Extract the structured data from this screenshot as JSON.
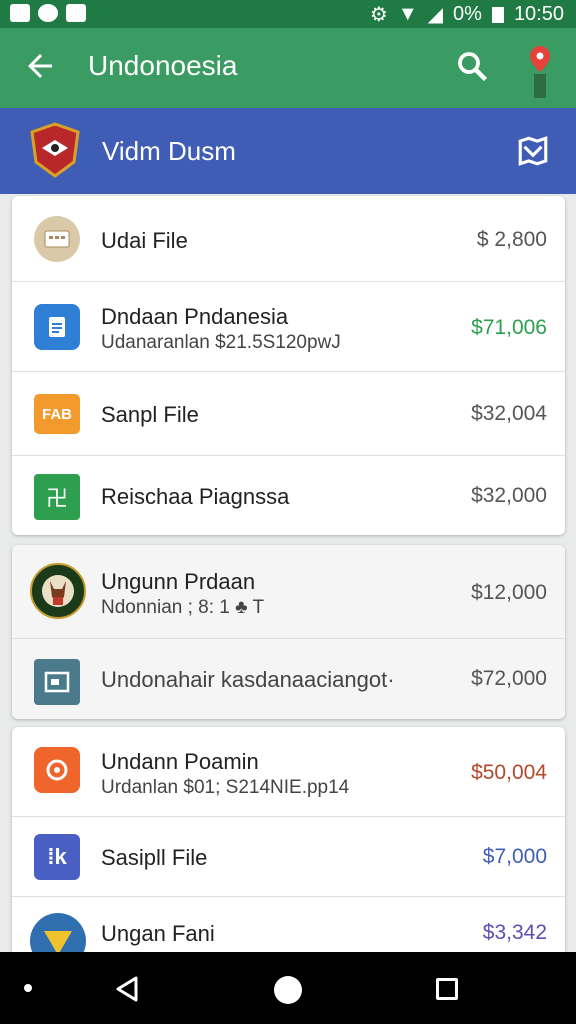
{
  "status_bar": {
    "battery": "0%",
    "time": "10:50"
  },
  "app_bar": {
    "title": "Undonoesia"
  },
  "sub_header": {
    "title": "Vidm Dusm"
  },
  "cards": [
    {
      "rows": [
        {
          "icon": "keyboard-icon",
          "icon_color": "#d9c9a8",
          "title": "Udai File",
          "subtitle": "",
          "amount": "$ 2,800",
          "amount_color": "#555555"
        },
        {
          "icon": "document-icon",
          "icon_color": "#2f7fd6",
          "title": "Dndaan Pndanesia",
          "subtitle": "Udanaranlan $21.5S120pwJ",
          "amount": "$71,006",
          "amount_color": "#2e9e4f"
        },
        {
          "icon": "folder-icon",
          "icon_color": "#f39a2d",
          "icon_text": "FAB",
          "title": "Sanpl File",
          "subtitle": "",
          "amount": "$32,004",
          "amount_color": "#555555"
        },
        {
          "icon": "spreadsheet-icon",
          "icon_color": "#2e9e4f",
          "icon_text": "卍",
          "title": "Reischaa Piagnssa",
          "subtitle": "",
          "amount": "$32,000",
          "amount_color": "#555555"
        }
      ]
    },
    {
      "rows": [
        {
          "icon": "emblem-icon",
          "icon_color": "#1a3a1a",
          "title": "Ungunn Prdaan",
          "subtitle": "Ndonnian ; 8: 1 ♣ T",
          "amount": "$12,000",
          "amount_color": "#555555"
        },
        {
          "icon": "presentation-icon",
          "icon_color": "#4b7a8c",
          "icon_text": "ᗴ",
          "title": "Undonahair kasdanaaciangot·",
          "subtitle": "",
          "amount": "$72,000",
          "amount_color": "#555555"
        }
      ]
    },
    {
      "rows": [
        {
          "icon": "audio-icon",
          "icon_color": "#f0652b",
          "title": "Undann Poamin",
          "subtitle": "Urdanlan $01; S214NIE.pp14",
          "amount": "$50,004",
          "amount_color": "#b5482a"
        },
        {
          "icon": "code-icon",
          "icon_color": "#4a5fc4",
          "icon_text": "⁞k",
          "title": "Sasipll File",
          "subtitle": "",
          "amount": "$7,000",
          "amount_color": "#3f5db4"
        },
        {
          "icon": "shield-icon",
          "icon_color": "#2f6fb0",
          "title": "Ungan Fani",
          "subtitle": "",
          "amount": "$3,342",
          "amount_color": "#5a4fb4"
        }
      ]
    }
  ]
}
